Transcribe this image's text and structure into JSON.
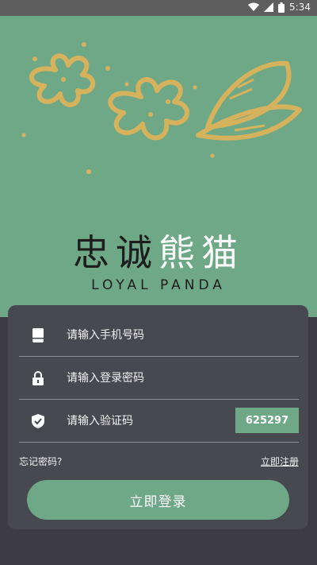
{
  "status_bar": {
    "time": "5:34"
  },
  "brand": {
    "title_dark": "忠诚",
    "title_light": "熊猫",
    "subtitle": "LOYAL PANDA"
  },
  "form": {
    "phone_placeholder": "请输入手机号码",
    "password_placeholder": "请输入登录密码",
    "code_placeholder": "请输入验证码",
    "code_value": "625297"
  },
  "links": {
    "forgot": "忘记密码?",
    "register": "立即注册"
  },
  "login": {
    "label": "立即登录"
  },
  "colors": {
    "accent": "#6fa886",
    "card": "#484850",
    "background": "#3d3c44",
    "gold": "#d6b25c"
  }
}
